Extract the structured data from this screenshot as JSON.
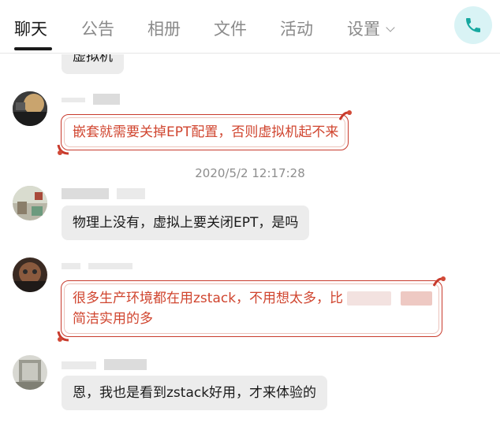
{
  "tabs": [
    {
      "label": "聊天",
      "active": true
    },
    {
      "label": "公告",
      "active": false
    },
    {
      "label": "相册",
      "active": false
    },
    {
      "label": "文件",
      "active": false
    },
    {
      "label": "活动",
      "active": false
    },
    {
      "label": "设置",
      "active": false,
      "dropdown": true
    }
  ],
  "call_button": {
    "icon": "phone-icon",
    "color": "#17a8a0"
  },
  "messages": [
    {
      "id": "m0",
      "text": "虚拟机",
      "style": "plain"
    },
    {
      "id": "m1",
      "text": "嵌套就需要关掉EPT配置，否则虚拟机起不来",
      "style": "festive"
    },
    {
      "id": "m2",
      "text": "物理上没有，虚拟上要关闭EPT，是吗",
      "style": "plain"
    },
    {
      "id": "m3",
      "line1": "很多生产环境都在用zstack，不用想太多，比",
      "line2": "简洁实用的多",
      "style": "festive"
    },
    {
      "id": "m4",
      "text": "恩，我也是看到zstack好用，才来体验的",
      "style": "plain"
    }
  ],
  "timestamp": "2020/5/2 12:17:28",
  "colors": {
    "festive_text": "#d0452f",
    "festive_border": "#c83a2c",
    "bubble_bg": "#ececec",
    "call_bg": "#d9f3f5"
  }
}
